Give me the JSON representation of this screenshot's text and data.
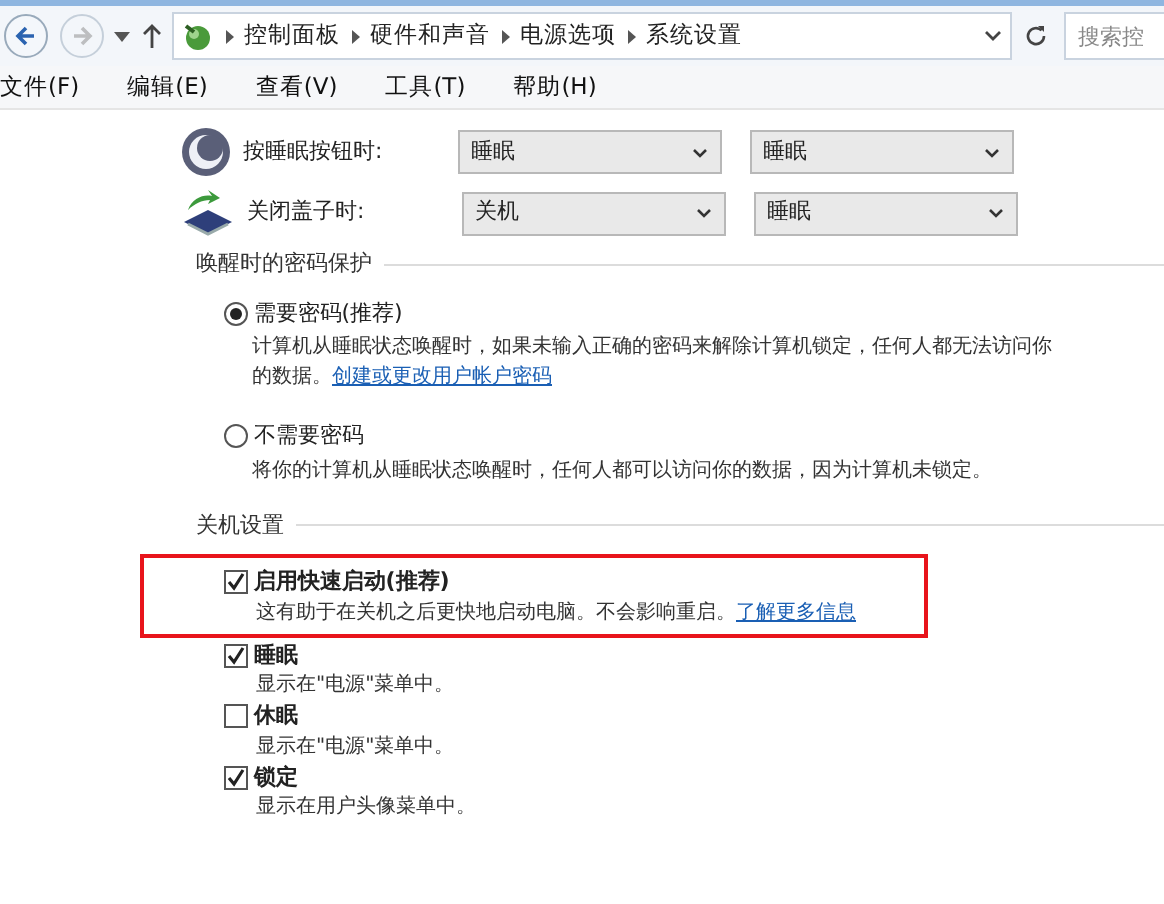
{
  "address_bar": {
    "breadcrumbs": [
      "控制面板",
      "硬件和声音",
      "电源选项",
      "系统设置"
    ]
  },
  "search": {
    "placeholder": "搜索控"
  },
  "menu": [
    "文件(F)",
    "编辑(E)",
    "查看(V)",
    "工具(T)",
    "帮助(H)"
  ],
  "power_rows": [
    {
      "kind": "sleep",
      "label": "按睡眠按钮时:",
      "values": [
        "睡眠",
        "睡眠"
      ]
    },
    {
      "kind": "lid",
      "label": "关闭盖子时:",
      "values": [
        "关机",
        "睡眠"
      ]
    }
  ],
  "password_section": {
    "title": "唤醒时的密码保护",
    "options": [
      {
        "label": "需要密码(推荐)",
        "selected": true,
        "description": "计算机从睡眠状态唤醒时，如果未输入正确的密码来解除计算机锁定，任何人都无法访问你的数据。",
        "link": "创建或更改用户帐户密码"
      },
      {
        "label": "不需要密码",
        "selected": false,
        "description": "将你的计算机从睡眠状态唤醒时，任何人都可以访问你的数据，因为计算机未锁定。"
      }
    ]
  },
  "shutdown_section": {
    "title": "关机设置",
    "options": [
      {
        "label": "启用快速启动(推荐)",
        "checked": true,
        "highlighted": true,
        "description": "这有助于在关机之后更快地启动电脑。不会影响重启。",
        "link": "了解更多信息"
      },
      {
        "label": "睡眠",
        "checked": true,
        "highlighted": false,
        "description": "显示在\"电源\"菜单中。"
      },
      {
        "label": "休眠",
        "checked": false,
        "highlighted": false,
        "description": "显示在\"电源\"菜单中。"
      },
      {
        "label": "锁定",
        "checked": true,
        "highlighted": false,
        "description": "显示在用户头像菜单中。"
      }
    ]
  }
}
